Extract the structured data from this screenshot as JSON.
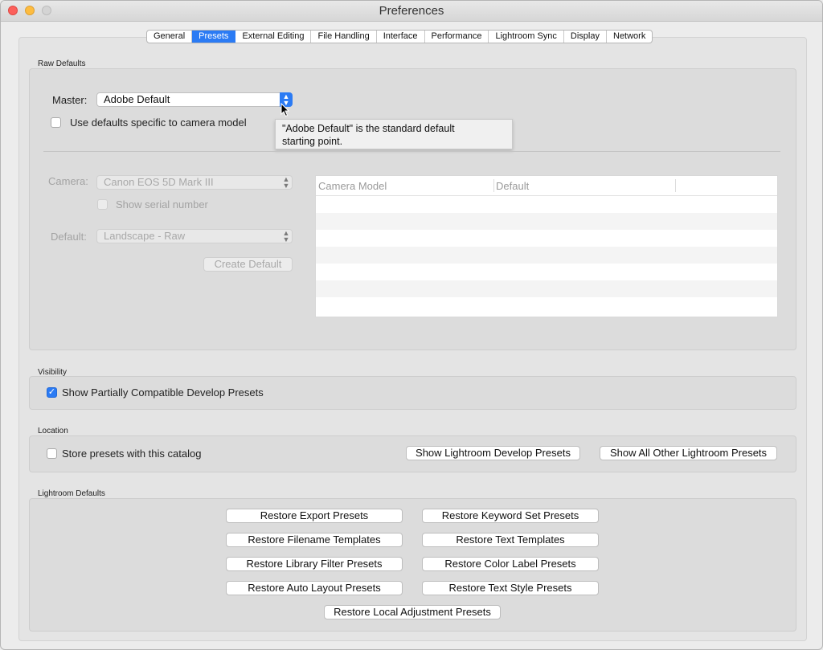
{
  "window": {
    "title": "Preferences"
  },
  "tabs": [
    {
      "label": "General",
      "active": false
    },
    {
      "label": "Presets",
      "active": true
    },
    {
      "label": "External Editing",
      "active": false
    },
    {
      "label": "File Handling",
      "active": false
    },
    {
      "label": "Interface",
      "active": false
    },
    {
      "label": "Performance",
      "active": false
    },
    {
      "label": "Lightroom Sync",
      "active": false
    },
    {
      "label": "Display",
      "active": false
    },
    {
      "label": "Network",
      "active": false
    }
  ],
  "raw_defaults": {
    "section_label": "Raw Defaults",
    "master_label": "Master:",
    "master_value": "Adobe Default",
    "camera_specific_label": "Use defaults specific to camera model",
    "camera_specific_checked": false,
    "tooltip_line1": "\"Adobe Default\" is the standard default",
    "tooltip_line2": "starting point.",
    "camera_label": "Camera:",
    "camera_value": "Canon EOS 5D Mark III",
    "serial_label": "Show serial number",
    "default_label": "Default:",
    "default_value": "Landscape - Raw",
    "create_default_label": "Create Default",
    "table": {
      "col_camera_model": "Camera Model",
      "col_default": "Default"
    }
  },
  "visibility": {
    "section_label": "Visibility",
    "show_partial_label": "Show Partially Compatible Develop Presets",
    "show_partial_checked": true
  },
  "location": {
    "section_label": "Location",
    "store_label": "Store presets with this catalog",
    "store_checked": false,
    "show_develop_label": "Show Lightroom Develop Presets",
    "show_other_label": "Show All Other Lightroom Presets"
  },
  "lightroom_defaults": {
    "section_label": "Lightroom Defaults",
    "restore_export": "Restore Export Presets",
    "restore_keyword": "Restore Keyword Set Presets",
    "restore_filename": "Restore Filename Templates",
    "restore_text_templates": "Restore Text Templates",
    "restore_library_filter": "Restore Library Filter Presets",
    "restore_color_label": "Restore Color Label Presets",
    "restore_auto_layout": "Restore Auto Layout Presets",
    "restore_text_style": "Restore Text Style Presets",
    "restore_local_adjustment": "Restore Local Adjustment Presets"
  },
  "colors": {
    "accent": "#2b7bf4"
  }
}
